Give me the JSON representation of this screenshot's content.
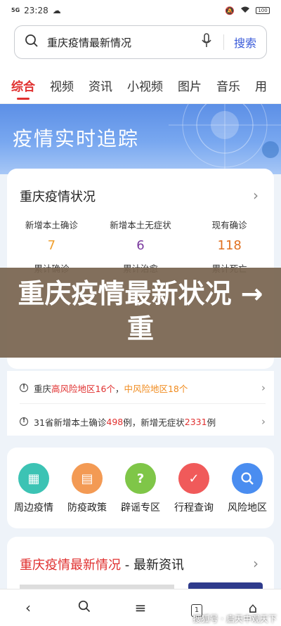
{
  "status_bar": {
    "network": "5G",
    "time": "23:28",
    "battery": "100"
  },
  "search": {
    "query": "重庆疫情最新情况",
    "button": "搜索"
  },
  "tabs": [
    "综合",
    "视频",
    "资讯",
    "小视频",
    "图片",
    "音乐",
    "用"
  ],
  "banner": {
    "title": "疫情实时追踪"
  },
  "status_card": {
    "title": "重庆疫情状况",
    "stats": [
      {
        "label": "新增本土确诊",
        "value": "7",
        "color": "#f0a030"
      },
      {
        "label": "新增本土无症状",
        "value": "6",
        "color": "#7a3a9e"
      },
      {
        "label": "现有确诊",
        "value": "118",
        "color": "#e07020"
      }
    ],
    "stats2": [
      "累计确诊",
      "累计治愈",
      "累计死亡"
    ]
  },
  "overlay": {
    "text": "重庆疫情最新状况 → 重"
  },
  "alerts": {
    "row1": {
      "prefix": "重庆",
      "high": "高风险地区16个",
      "sep": "，",
      "mid": "中风险地区18个"
    },
    "row2": {
      "a": "31省新增本土确诊",
      "b": "498",
      "c": "例，新增无症状",
      "d": "2331",
      "e": "例"
    }
  },
  "quick_links": [
    {
      "label": "周边疫情",
      "icon": "building-icon",
      "color": "#3cc3b4"
    },
    {
      "label": "防疫政策",
      "icon": "policy-icon",
      "color": "#f39a54"
    },
    {
      "label": "辟谣专区",
      "icon": "question-icon",
      "color": "#7fc648"
    },
    {
      "label": "行程查询",
      "icon": "document-icon",
      "color": "#f05a5a"
    },
    {
      "label": "风险地区",
      "icon": "search-icon",
      "color": "#4a8df0"
    }
  ],
  "news": {
    "title_red": "重庆疫情最新情况",
    "title_rest": " - 最新资讯"
  },
  "watermark": "搜狐号 · 启天中观天下",
  "bottom_nav": {
    "tab_count": "1"
  }
}
